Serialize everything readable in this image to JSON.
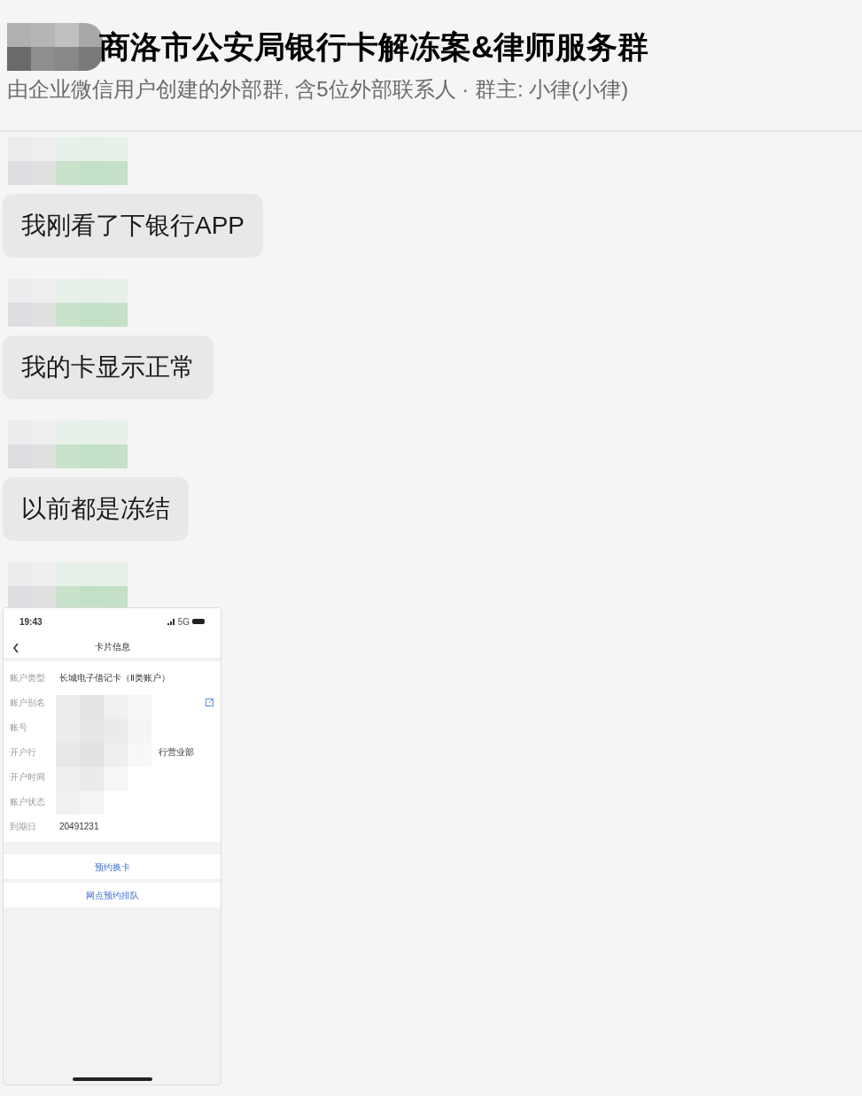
{
  "group": {
    "title": "商洛市公安局银行卡解冻案&律师服务群",
    "subtitle": "由企业微信用户创建的外部群, 含5位外部联系人 · 群主: 小律(小律)"
  },
  "messages": [
    {
      "kind": "text",
      "text": "我刚看了下银行APP"
    },
    {
      "kind": "text",
      "text": "我的卡显示正常"
    },
    {
      "kind": "text",
      "text": "以前都是冻结"
    },
    {
      "kind": "screenshot",
      "screen": {
        "time": "19:43",
        "network": "5G",
        "title": "卡片信息",
        "fields": [
          {
            "label": "账户类型",
            "value": "长城电子借记卡（Ⅱ类账户）",
            "editable": false
          },
          {
            "label": "账户别名",
            "editable": true
          },
          {
            "label": "账号",
            "editable": false
          },
          {
            "label": "开户行",
            "value": "行营业部",
            "editable": false
          },
          {
            "label": "开户时间",
            "editable": false
          },
          {
            "label": "账户状态",
            "editable": false
          },
          {
            "label": "到期日",
            "value": "20491231",
            "editable": false
          }
        ],
        "actions": [
          "预约换卡",
          "网点预约排队"
        ]
      }
    }
  ]
}
